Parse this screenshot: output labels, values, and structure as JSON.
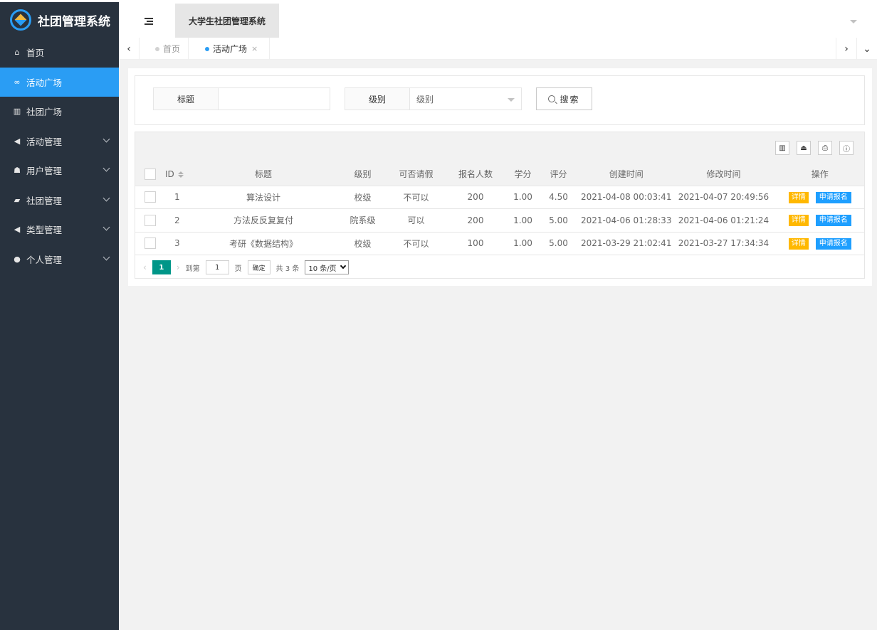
{
  "app": {
    "logo_text": "社团管理系统",
    "header_title": "大学生社团管理系统"
  },
  "sidebar": {
    "items": [
      {
        "label": "首页",
        "icon": "home-icon",
        "glyph": "⌂",
        "active": false,
        "expandable": false
      },
      {
        "label": "活动广场",
        "icon": "binoculars-icon",
        "glyph": "∞",
        "active": true,
        "expandable": false
      },
      {
        "label": "社团广场",
        "icon": "bank-icon",
        "glyph": "▥",
        "active": false,
        "expandable": false
      },
      {
        "label": "活动管理",
        "icon": "paper-plane-icon",
        "glyph": "◀",
        "active": false,
        "expandable": true
      },
      {
        "label": "用户管理",
        "icon": "users-icon",
        "glyph": "☗",
        "active": false,
        "expandable": true
      },
      {
        "label": "社团管理",
        "icon": "book-icon",
        "glyph": "▰",
        "active": false,
        "expandable": true
      },
      {
        "label": "类型管理",
        "icon": "paper-plane-icon",
        "glyph": "◀",
        "active": false,
        "expandable": true
      },
      {
        "label": "个人管理",
        "icon": "user-icon",
        "glyph": "●",
        "active": false,
        "expandable": true
      }
    ]
  },
  "tabs": [
    {
      "label": "首页",
      "current": false
    },
    {
      "label": "活动广场",
      "current": true,
      "closable": true
    }
  ],
  "tab_close_glyph": "×",
  "search": {
    "title_label": "标题",
    "title_value": "",
    "level_label": "级别",
    "level_selected": "级别",
    "button_label": "搜索"
  },
  "table": {
    "columns": [
      "ID",
      "标题",
      "级别",
      "可否请假",
      "报名人数",
      "学分",
      "评分",
      "创建时间",
      "修改时间",
      "操作"
    ],
    "rows": [
      {
        "id": "1",
        "title": "算法设计",
        "level": "校级",
        "leave": "不可以",
        "count": "200",
        "credit": "1.00",
        "score": "4.50",
        "created": "2021-04-08 00:03:41",
        "modified": "2021-04-07 20:49:56"
      },
      {
        "id": "2",
        "title": "方法反反复复付",
        "level": "院系级",
        "leave": "可以",
        "count": "200",
        "credit": "1.00",
        "score": "5.00",
        "created": "2021-04-06 01:28:33",
        "modified": "2021-04-06 01:21:24"
      },
      {
        "id": "3",
        "title": "考研《数据结构》",
        "level": "校级",
        "leave": "不可以",
        "count": "100",
        "credit": "1.00",
        "score": "5.00",
        "created": "2021-03-29 21:02:41",
        "modified": "2021-03-27 17:34:34"
      }
    ],
    "action_detail": "详情",
    "action_apply": "申请报名"
  },
  "pager": {
    "current": "1",
    "goto_prefix": "到第",
    "goto_value": "1",
    "goto_suffix": "页",
    "confirm": "确定",
    "total": "共 3 条",
    "page_size": "10 条/页"
  },
  "colors": {
    "sidebar_bg": "#28323e",
    "accent": "#2a9df4",
    "detail_btn": "#ffb800",
    "apply_btn": "#1e9fff",
    "pager_current": "#009688"
  }
}
